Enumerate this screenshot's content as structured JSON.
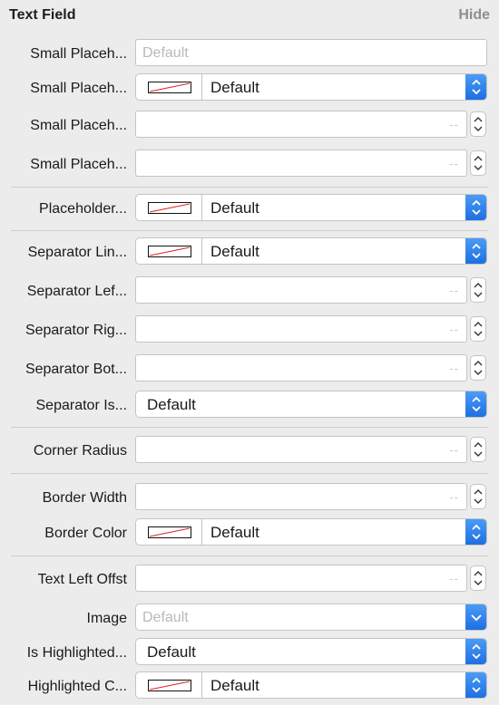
{
  "header": {
    "title": "Text Field",
    "hide_label": "Hide"
  },
  "rows": [
    {
      "label": "Small Placeh...",
      "placeholder": "Default"
    },
    {
      "label": "Small Placeh...",
      "value": "Default"
    },
    {
      "label": "Small Placeh...",
      "value": "--"
    },
    {
      "label": "Small Placeh...",
      "value": "--"
    },
    {
      "label": "Placeholder...",
      "value": "Default"
    },
    {
      "label": "Separator Lin...",
      "value": "Default"
    },
    {
      "label": "Separator Lef...",
      "value": "--"
    },
    {
      "label": "Separator Rig...",
      "value": "--"
    },
    {
      "label": "Separator Bot...",
      "value": "--"
    },
    {
      "label": "Separator Is...",
      "value": "Default"
    },
    {
      "label": "Corner Radius",
      "value": "--"
    },
    {
      "label": "Border Width",
      "value": "--"
    },
    {
      "label": "Border Color",
      "value": "Default"
    },
    {
      "label": "Text Left Offst",
      "value": "--"
    },
    {
      "label": "Image",
      "placeholder": "Default"
    },
    {
      "label": "Is Highlighted...",
      "value": "Default"
    },
    {
      "label": "Highlighted C...",
      "value": "Default"
    }
  ],
  "colors": {
    "accent": "#1c6ee0",
    "swatch_slash": "#e02020",
    "panel_bg": "#ececec"
  },
  "icons": {
    "stepper": "up-down-arrows-icon",
    "popup": "chevron-updown-icon",
    "combo": "chevron-down-icon",
    "swatch": "no-color-swatch-icon"
  }
}
